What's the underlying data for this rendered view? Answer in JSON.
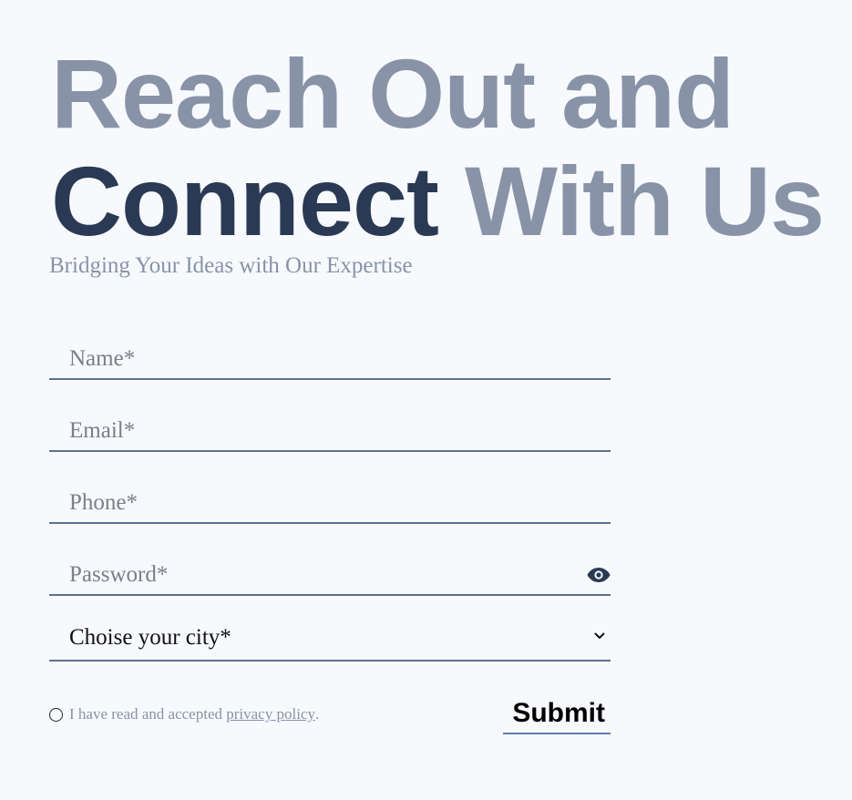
{
  "hero": {
    "line1": "Reach Out and",
    "line2_emphasis": "Connect",
    "line2_rest": "With Us",
    "subtitle": "Bridging Your Ideas with Our Expertise"
  },
  "form": {
    "name_placeholder": "Name*",
    "email_placeholder": "Email*",
    "phone_placeholder": "Phone*",
    "password_placeholder": "Password*",
    "password_toggle_icon": "eye-icon",
    "city_select": {
      "selected": "Choise your city*",
      "icon": "chevron-down-icon"
    },
    "consent": {
      "text_before": "I have read and accepted",
      "link_text": "privacy policy",
      "text_after": "."
    },
    "submit_label": "Submit"
  },
  "colors": {
    "background": "#f7f9fc",
    "heading_light": "#8893a8",
    "heading_dark": "#2a3a55",
    "field_border": "#5e6f8f",
    "submit_underline": "#5e80b8"
  }
}
